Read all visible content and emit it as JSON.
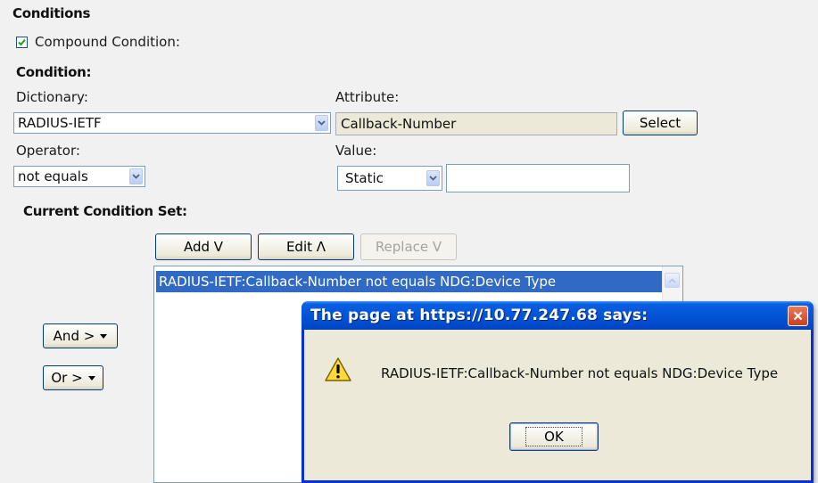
{
  "conditions": {
    "section_title": "Conditions",
    "compound": {
      "label": "Compound Condition:",
      "checked": true
    },
    "condition_title": "Condition:",
    "dictionary": {
      "label": "Dictionary:",
      "value": "RADIUS-IETF"
    },
    "attribute": {
      "label": "Attribute:",
      "value": "Callback-Number",
      "select_label": "Select"
    },
    "operator": {
      "label": "Operator:",
      "value": "not equals"
    },
    "value": {
      "label": "Value:",
      "type": "Static",
      "text": ""
    },
    "current_set_title": "Current Condition Set:",
    "buttons": {
      "add": "Add V",
      "edit": "Edit Λ",
      "replace": "Replace V"
    },
    "list_items": [
      "RADIUS-IETF:Callback-Number not equals NDG:Device Type"
    ],
    "and_label": "And >",
    "or_label": "Or >"
  },
  "dialog": {
    "title": "The page at https://10.77.247.68 says:",
    "message": "RADIUS-IETF:Callback-Number not equals NDG:Device Type",
    "ok_label": "OK",
    "icon": "warning-icon"
  },
  "colors": {
    "selection": "#316ac5",
    "titlebar": "#0454d6",
    "close": "#c9401b"
  }
}
